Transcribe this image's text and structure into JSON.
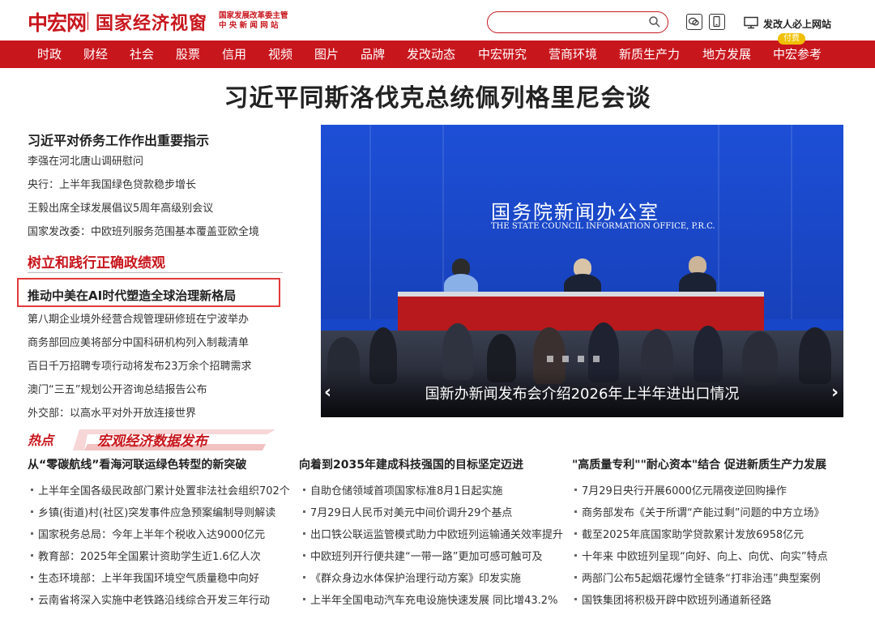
{
  "header": {
    "logo_cn": "中宏网",
    "site_title": "国家经济视窗",
    "sub_line1": "国家发展改革委主管",
    "sub_line2": "中 央 新 闻 网 站",
    "search_placeholder": "",
    "site_link": "发改人必上网站"
  },
  "nav": {
    "items": [
      "时政",
      "财经",
      "社会",
      "股票",
      "信用",
      "视频",
      "图片",
      "品牌",
      "发改动态",
      "中宏研究",
      "营商环境",
      "新质生产力",
      "地方发展",
      "中宏参考"
    ],
    "badge": "付费"
  },
  "headline": "习近平同斯洛伐克总统佩列格里尼会谈",
  "left": {
    "lead_title": "习近平对侨务工作作出重要指示",
    "links_top": [
      "李强在河北唐山调研慰问",
      "央行：上半年我国绿色贷款稳步增长",
      "王毅出席全球发展倡议5周年高级别会议",
      "国家发改委：中欧班列服务范围基本覆盖亚欧全境"
    ],
    "section_title": "树立和践行正确政绩观",
    "boxed_title": "推动中美在AI时代塑造全球治理新格局",
    "links_bottom": [
      "第八期企业境外经营合规管理研修班在宁波举办",
      "商务部回应美将部分中国科研机构列入制裁清单",
      "百日千万招聘专项行动将发布23万余个招聘需求",
      "澳门“三五”规划公开咨询总结报告公布",
      "外交部：以高水平对外开放连接世界"
    ]
  },
  "slider": {
    "org_cn": "国务院新闻办公室",
    "org_en": "THE STATE COUNCIL INFORMATION OFFICE, P.R.C.",
    "caption": "国新办新闻发布会介绍2026年上半年进出口情况",
    "prev": "‹",
    "next": "›"
  },
  "hot": {
    "tag": "热点",
    "title": "宏观经济数据发布"
  },
  "columns": [
    {
      "title": "从“零碳航线”看海河联运绿色转型的新突破",
      "items": [
        "上半年全国各级民政部门累计处置非法社会组织702个",
        "乡镇(街道)村(社区)突发事件应急预案编制导则解读",
        "国家税务总局：今年上半年个税收入达9000亿元",
        "教育部：2025年全国累计资助学生近1.6亿人次",
        "生态环境部：上半年我国环境空气质量稳中向好",
        "云南省将深入实施中老铁路沿线综合开发三年行动"
      ]
    },
    {
      "title": "向着到2035年建成科技强国的目标坚定迈进",
      "items": [
        "自助仓储领域首项国家标准8月1日起实施",
        "7月29日人民币对美元中间价调升29个基点",
        "出口铁公联运监管模式助力中欧班列运输通关效率提升",
        "中欧班列开行便共建“一带一路”更加可感可触可及",
        "《群众身边水体保护治理行动方案》印发实施",
        "上半年全国电动汽车充电设施快速发展 同比增43.2%"
      ]
    },
    {
      "title": "\"高质量专利\"\"耐心资本\"结合 促进新质生产力发展",
      "items": [
        "7月29日央行开展6000亿元隔夜逆回购操作",
        "商务部发布《关于所谓“产能过剩”问题的中方立场》",
        "截至2025年底国家助学贷款累计发放6958亿元",
        "十年来 中欧班列呈现“向好、向上、向优、向实”特点",
        "两部门公布5起烟花爆竹全链条“打非治违”典型案例",
        "国铁集团将积极开辟中欧班列通道新径路"
      ]
    }
  ],
  "colors": {
    "brand_red": "#c8161d",
    "badge_gold": "#f0c000",
    "slider_blue": "#1846c8"
  }
}
